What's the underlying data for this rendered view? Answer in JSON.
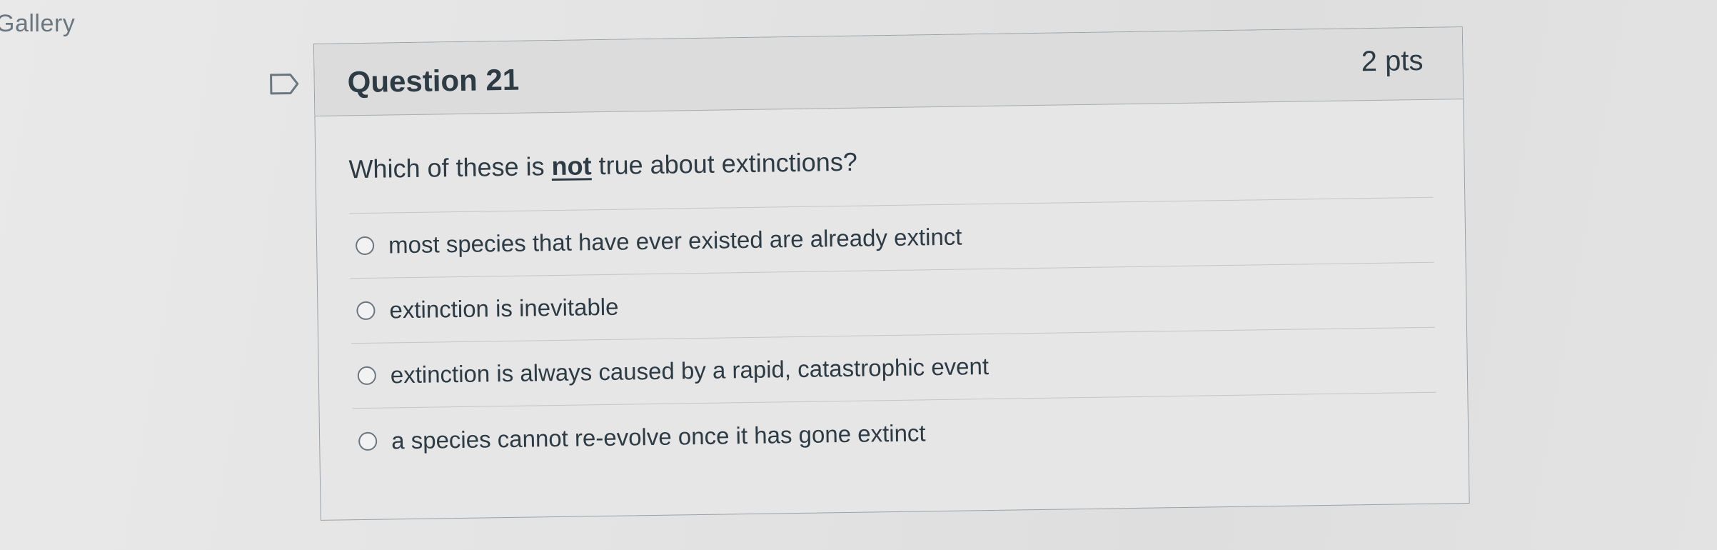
{
  "app": {
    "gallery_label": "Gallery"
  },
  "question": {
    "title": "Question 21",
    "points": "2 pts",
    "text_before": "Which of these is ",
    "text_emphasis": "not",
    "text_after": " true about extinctions?",
    "flag_icon": "flag-outline-icon"
  },
  "answers": [
    {
      "label": "most species that have ever existed are already extinct",
      "selected": false
    },
    {
      "label": "extinction is inevitable",
      "selected": false
    },
    {
      "label": "extinction is always caused by a rapid, catastrophic event",
      "selected": false
    },
    {
      "label": "a species cannot re-evolve once it has gone extinct",
      "selected": false
    }
  ],
  "colors": {
    "text": "#2d3b45",
    "border": "#9aa1a6",
    "header_bg": "#dcdcdc",
    "card_bg": "#e6e6e6"
  }
}
